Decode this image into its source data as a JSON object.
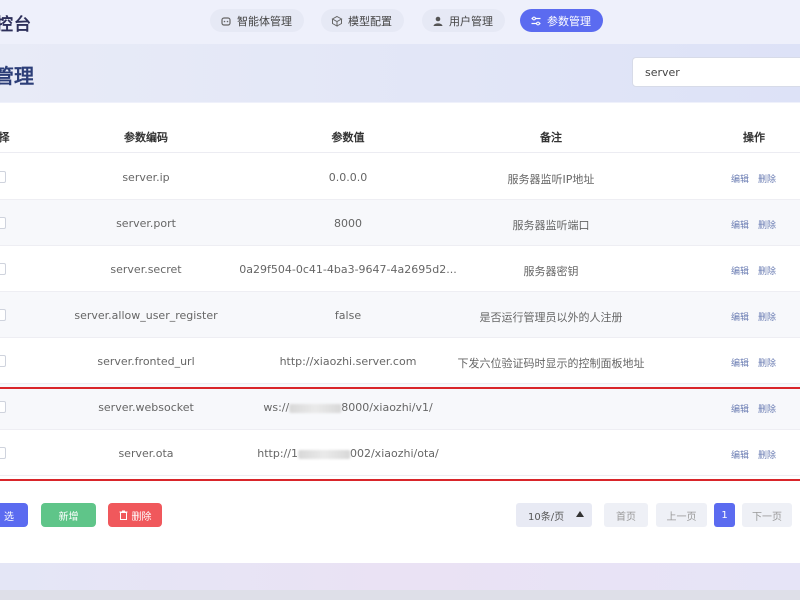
{
  "app": {
    "brand": "控台"
  },
  "nav": {
    "tabs": [
      {
        "label": "智能体管理",
        "icon": "robot-icon"
      },
      {
        "label": "模型配置",
        "icon": "cube-icon"
      },
      {
        "label": "用户管理",
        "icon": "user-icon"
      },
      {
        "label": "参数管理",
        "icon": "sliders-icon",
        "active": true
      }
    ]
  },
  "header": {
    "title": "管理"
  },
  "search": {
    "value": "server",
    "placeholder": ""
  },
  "table": {
    "headers": {
      "select": "择",
      "code": "参数编码",
      "value": "参数值",
      "note": "备注",
      "ops": "操作"
    },
    "rows": [
      {
        "code": "server.ip",
        "value": "0.0.0.0",
        "note": "服务器监听IP地址"
      },
      {
        "code": "server.port",
        "value": "8000",
        "note": "服务器监听端口"
      },
      {
        "code": "server.secret",
        "value": "0a29f504-0c41-4ba3-9647-4a2695d2...",
        "note": "服务器密钥"
      },
      {
        "code": "server.allow_user_register",
        "value": "false",
        "note": "是否运行管理员以外的人注册"
      },
      {
        "code": "server.fronted_url",
        "value": "http://xiaozhi.server.com",
        "note": "下发六位验证码时显示的控制面板地址"
      },
      {
        "code": "server.websocket",
        "value_prefix": "ws://",
        "value_suffix": "8000/xiaozhi/v1/",
        "note": ""
      },
      {
        "code": "server.ota",
        "value_prefix": "http://1",
        "value_suffix": "002/xiaozhi/ota/",
        "note": ""
      }
    ],
    "edit_label": "编辑",
    "delete_label": "删除"
  },
  "footer": {
    "select_all": "选",
    "add": "新增",
    "delete": "删除",
    "page_size": "10条/页",
    "first": "首页",
    "prev": "上一页",
    "current": "1",
    "next": "下一页"
  },
  "colors": {
    "primary": "#5b6bf0",
    "add": "#5fc589",
    "danger": "#f0585c",
    "highlight": "#d9252a"
  }
}
